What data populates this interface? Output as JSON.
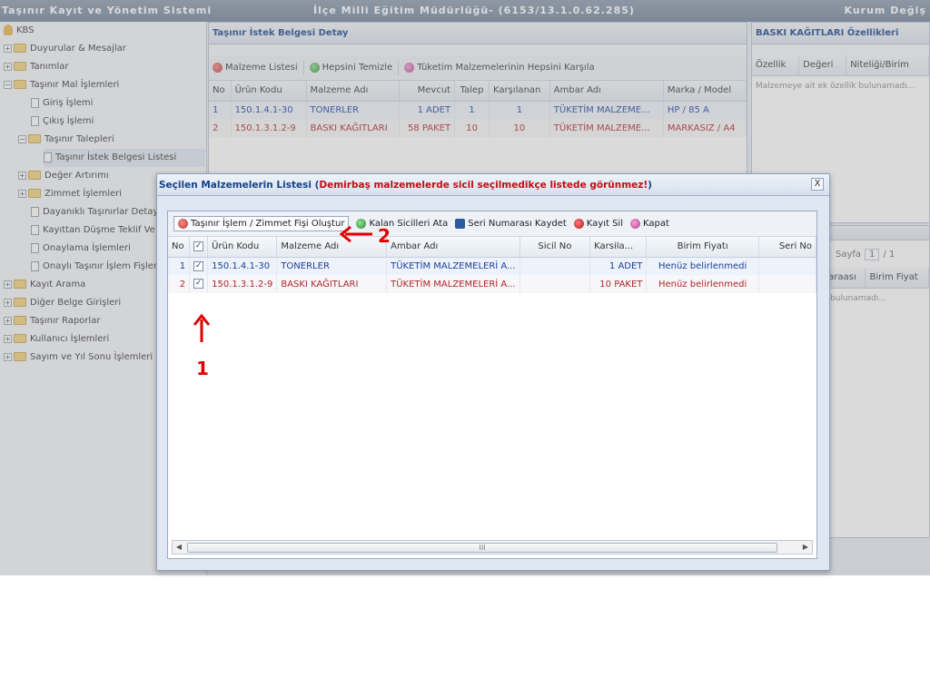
{
  "titlebar": {
    "left": "Taşınır Kayıt ve Yönetim Sistemi",
    "center": "İlçe Milli Eğitim Müdürlüğü- (6153/13.1.0.62.285)",
    "right": "Kurum Değiş"
  },
  "sidebar": {
    "root": "KBS",
    "items": [
      {
        "label": "Duyurular & Mesajlar"
      },
      {
        "label": "Tanımlar"
      },
      {
        "label": "Taşınır Mal İşlemleri"
      },
      {
        "label": "Giriş İşlemi"
      },
      {
        "label": "Çıkış İşlemi"
      },
      {
        "label": "Taşınır Talepleri"
      },
      {
        "label": "Taşınır İstek Belgesi Listesi"
      },
      {
        "label": "Değer Artırımı"
      },
      {
        "label": "Zimmet İşlemleri"
      },
      {
        "label": "Dayanıklı Taşınırlar Detay Bilg"
      },
      {
        "label": "Kayıttan Düşme Teklif Ve Ona"
      },
      {
        "label": "Onaylama İşlemleri"
      },
      {
        "label": "Onaylı Taşınır İşlem Fişleri"
      },
      {
        "label": "Kayıt Arama"
      },
      {
        "label": "Diğer Belge Girişleri"
      },
      {
        "label": "Taşınır Raporlar"
      },
      {
        "label": "Kullanıcı İşlemleri"
      },
      {
        "label": "Sayım ve Yıl Sonu İşlemleri"
      }
    ]
  },
  "detail": {
    "title": "Taşınır İstek Belgesi Detay",
    "toolbar": {
      "list": "Malzeme Listesi",
      "clear_all": "Hepsini Temizle",
      "meet_all": "Tüketim Malzemelerinin Hepsini Karşıla"
    },
    "columns": [
      "No",
      "Ürün Kodu",
      "Malzeme Adı",
      "Mevcut",
      "Talep",
      "Karşılanan",
      "Ambar Adı",
      "Marka / Model"
    ],
    "rows": [
      [
        "1",
        "150.1.4.1-30",
        "TONERLER",
        "1  ADET",
        "1",
        "1",
        "TÜKETİM MALZEME...",
        "HP / 85 A"
      ],
      [
        "2",
        "150.1.3.1.2-9",
        "BASKI KAĞITLARI",
        "58  PAKET",
        "10",
        "10",
        "TÜKETİM MALZEME...",
        "MARKASIZ / A4"
      ]
    ]
  },
  "properties": {
    "title": "BASKI KAĞITLARI Özellikleri",
    "columns": [
      "Özellik",
      "Değeri",
      "Niteliği/Birim"
    ],
    "empty": "Malzemeye ait ek özellik bulunamadı...",
    "pager_label": "Sayfa",
    "pager_value": "1",
    "pager_total": "/ 1",
    "columns2": [
      "maraası",
      "Birim Fiyat"
    ],
    "empty2": "sı bulunamadı..."
  },
  "modal": {
    "title_main": "Seçilen Malzemelerin Listesi (",
    "title_warn": "Demirbaş malzemelerde sicil seçilmedikçe listede görünmez!",
    "title_end": ")",
    "close": "X",
    "toolbar": {
      "create": "Taşınır İşlem / Zimmet Fişi Oluştur",
      "assign": "Kalan Sicilleri Ata",
      "save_serial": "Seri Numarası Kaydet",
      "delete": "Kayıt Sil",
      "close": "Kapat"
    },
    "columns": [
      "No",
      "",
      "Ürün Kodu",
      "Malzeme Adı",
      "Ambar Adı",
      "Sicil No",
      "Karsila...",
      "Birim Fiyatı",
      "Seri No"
    ],
    "rows": [
      {
        "no": "1",
        "checked": "✓",
        "code": "150.1.4.1-30",
        "name": "TONERLER",
        "store": "TÜKETİM MALZEMELERİ A...",
        "sicil": "",
        "karsila": "1  ADET",
        "price": "Henüz belirlenmedi",
        "serial": ""
      },
      {
        "no": "2",
        "checked": "✓",
        "code": "150.1.3.1.2-9",
        "name": "BASKI KAĞITLARI",
        "store": "TÜKETİM MALZEMELERİ A...",
        "sicil": "",
        "karsila": "10  PAKET",
        "price": "Henüz belirlenmedi",
        "serial": ""
      }
    ],
    "scroll_grip": "III"
  },
  "annotations": {
    "one": "1",
    "two": "2",
    "color": "#e00000"
  }
}
